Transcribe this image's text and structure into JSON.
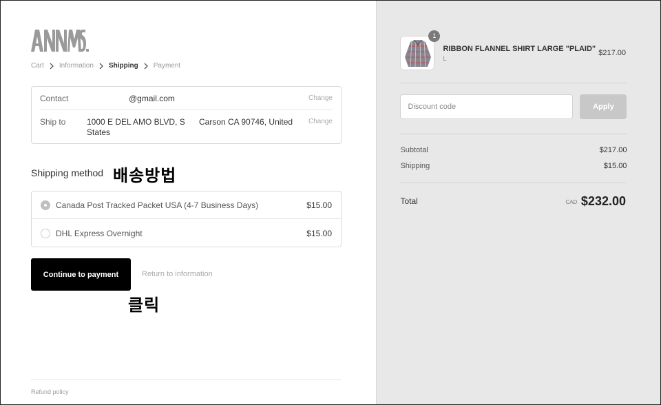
{
  "brand": {
    "logo_text": "ANNMS."
  },
  "breadcrumb": {
    "items": [
      "Cart",
      "Information",
      "Shipping",
      "Payment"
    ]
  },
  "review": {
    "contact": {
      "label": "Contact",
      "value": "@gmail.com",
      "change": "Change"
    },
    "ship_to": {
      "label": "Ship to",
      "address_line1": "1000 E DEL AMO BLVD, S",
      "address_line1b": "States",
      "address_line2": "Carson CA 90746, United",
      "change": "Change"
    }
  },
  "shipping_method": {
    "title": "Shipping method",
    "options": [
      {
        "label": "Canada Post Tracked Packet USA (4-7 Business Days)",
        "price": "$15.00",
        "selected": true
      },
      {
        "label": "DHL Express Overnight",
        "price": "$15.00",
        "selected": false
      }
    ]
  },
  "annotations": {
    "shipping_method_ko": "배송방법",
    "click_ko": "클릭"
  },
  "actions": {
    "continue_label": "Continue to payment",
    "return_label": "Return to information"
  },
  "footer": {
    "refund_policy": "Refund policy"
  },
  "cart": {
    "item": {
      "name": "RIBBON FLANNEL SHIRT LARGE \"PLAID\"",
      "variant": "L",
      "price": "$217.00",
      "quantity": "1"
    },
    "discount": {
      "placeholder": "Discount code",
      "apply_label": "Apply"
    },
    "subtotal": {
      "label": "Subtotal",
      "value": "$217.00"
    },
    "shipping": {
      "label": "Shipping",
      "value": "$15.00"
    },
    "total": {
      "label": "Total",
      "currency": "CAD",
      "value": "$232.00"
    }
  },
  "colors": {
    "primary_button": "#000000",
    "sidebar_background": "#e8e8e8",
    "apply_button_disabled": "#c8c8c8",
    "logo": "#9a9a9a"
  }
}
